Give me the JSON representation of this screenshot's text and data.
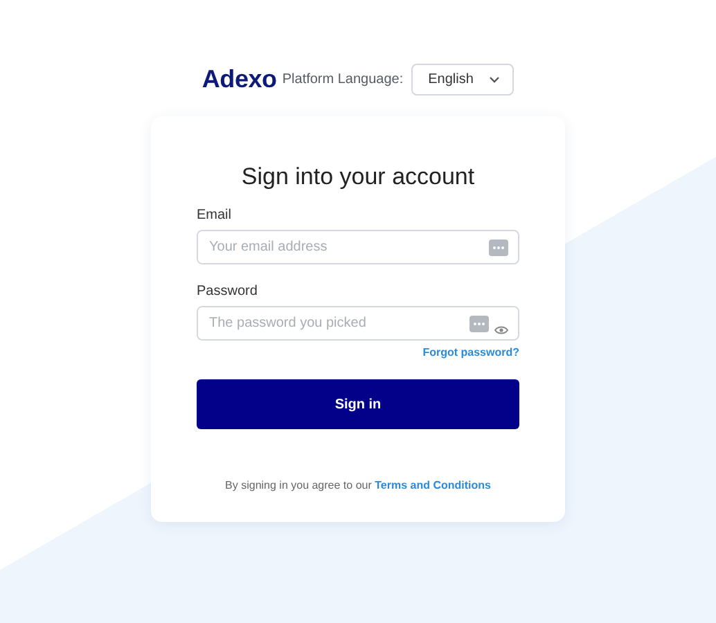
{
  "header": {
    "logo": "Adexo",
    "language_label": "Platform Language:",
    "language_select": {
      "value": "English"
    }
  },
  "card": {
    "title": "Sign into your account",
    "fields": [
      {
        "label": "Email",
        "placeholder": "Your email address",
        "kind": "text"
      },
      {
        "label": "Password",
        "placeholder": "The password you picked",
        "kind": "password"
      }
    ],
    "forgot_link": "Forgot password?",
    "submit": "Sign in",
    "terms": {
      "text": "By signing in you agree to our",
      "link": "Terms and Conditions"
    }
  }
}
